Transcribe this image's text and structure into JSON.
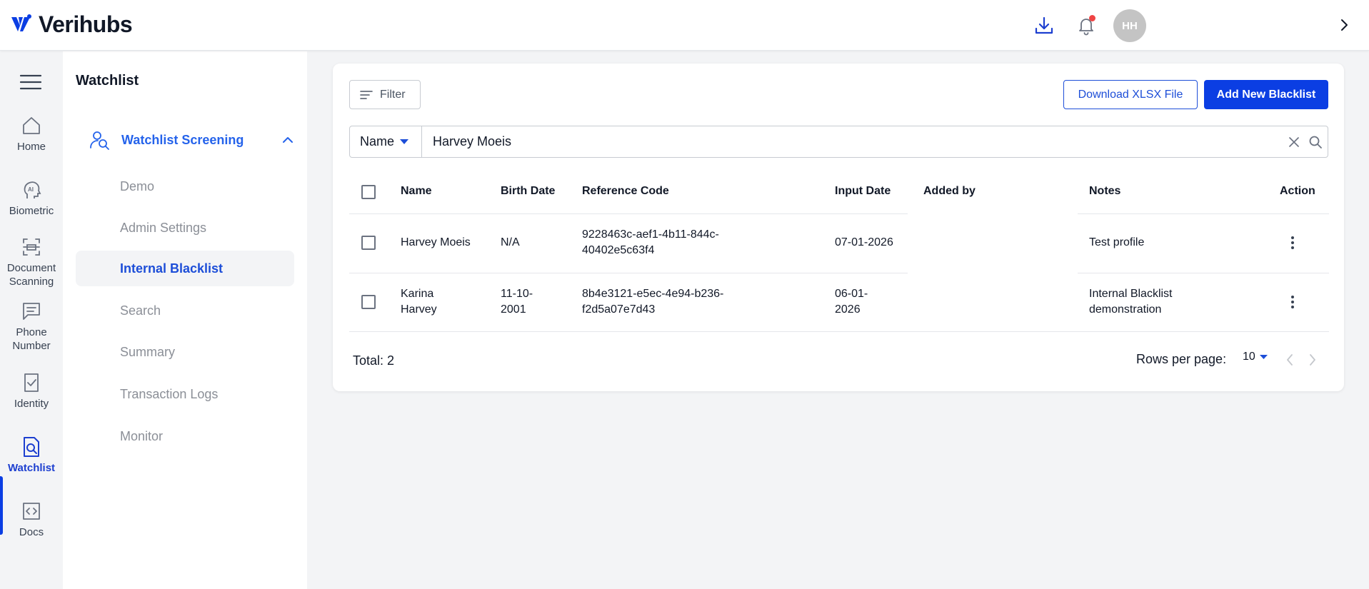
{
  "brand": {
    "name": "Verihubs",
    "accent": "#0b3ee3"
  },
  "header": {
    "avatar_initials": "HH",
    "icons": [
      "download-icon",
      "bell-icon",
      "chevron-right-icon"
    ],
    "notification_dot_color": "#ef4444"
  },
  "rail": {
    "items": [
      {
        "label": "Home",
        "icon": "home-icon"
      },
      {
        "label": "Biometric",
        "icon": "ai-face-icon"
      },
      {
        "label": "Document Scanning",
        "icon": "document-scan-icon"
      },
      {
        "label": "Phone Number",
        "icon": "message-icon"
      },
      {
        "label": "Identity",
        "icon": "id-check-icon"
      },
      {
        "label": "Watchlist",
        "icon": "watchlist-icon",
        "active": true
      },
      {
        "label": "Docs",
        "icon": "code-icon"
      }
    ]
  },
  "subnav": {
    "title": "Watchlist",
    "group_label": "Watchlist Screening",
    "items": [
      {
        "label": "Demo"
      },
      {
        "label": "Admin Settings"
      },
      {
        "label": "Internal Blacklist",
        "active": true
      },
      {
        "label": "Search"
      },
      {
        "label": "Summary"
      },
      {
        "label": "Transaction Logs"
      },
      {
        "label": "Monitor"
      }
    ]
  },
  "toolbar": {
    "filter_label": "Filter",
    "download_label": "Download XLSX File",
    "add_label": "Add New Blacklist"
  },
  "search": {
    "field_option": "Name",
    "value": "Harvey Moeis"
  },
  "table": {
    "columns": [
      "Name",
      "Birth Date",
      "Reference Code",
      "Input Date",
      "Added by",
      "Notes",
      "Action"
    ],
    "rows": [
      {
        "name": [
          "Harvey Moeis"
        ],
        "birth_date": [
          "N/A"
        ],
        "reference_code": [
          "9228463c-aef1-4b11-844c-",
          "40402e5c63f4"
        ],
        "input_date": [
          "07-01-2026"
        ],
        "added_by": "",
        "notes": [
          "Test profile"
        ]
      },
      {
        "name": [
          "Karina",
          "Harvey"
        ],
        "birth_date": [
          "11-10-",
          "2001"
        ],
        "reference_code": [
          "8b4e3121-e5ec-4e94-b236-",
          "f2d5a07e7d43"
        ],
        "input_date": [
          "06-01-",
          "2026"
        ],
        "added_by": "",
        "notes": [
          "Internal Blacklist",
          "demonstration"
        ]
      }
    ]
  },
  "footer": {
    "total_label": "Total: 2",
    "rows_per_page_label": "Rows per page:",
    "rows_per_page_value": "10"
  }
}
